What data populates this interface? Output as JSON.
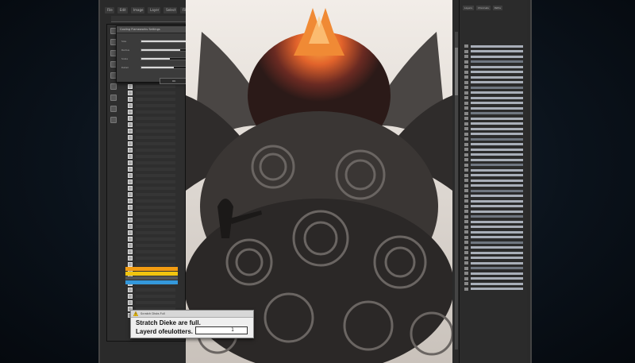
{
  "menu": {
    "items": [
      "File",
      "Edit",
      "Image",
      "Layer",
      "Select",
      "Filter"
    ]
  },
  "dialog": {
    "title": "Cooling Flameworks Settings",
    "sliders": [
      {
        "label": "Size",
        "value": 0.62
      },
      {
        "label": "Radius",
        "value": 0.48
      },
      {
        "label": "Scale",
        "value": 0.35
      },
      {
        "label": "Detail",
        "value": 0.4
      }
    ],
    "ok_label": "OK",
    "cancel_label": "Cancel"
  },
  "layers": {
    "count": 37
  },
  "right_panel": {
    "tabs": [
      "Layers",
      "Channels",
      "Paths"
    ]
  },
  "alert": {
    "title": "Scratch Disks Full",
    "message_line1": "Stratch Dieke are full.",
    "message_line2": "Layerd ofeulotters.",
    "input_value": "1"
  },
  "colors": {
    "selection_orange": "#f39c12",
    "selection_yellow": "#f1c40f",
    "selection_blue": "#3498db"
  }
}
